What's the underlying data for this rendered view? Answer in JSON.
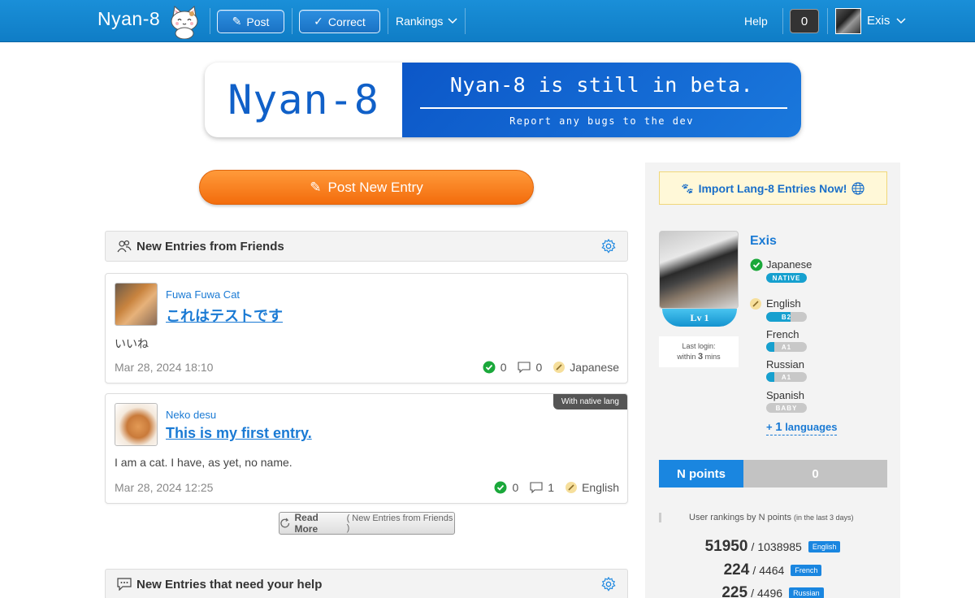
{
  "nav": {
    "brand": "Nyan-8",
    "post_label": "Post",
    "correct_label": "Correct",
    "rankings_label": "Rankings",
    "help_label": "Help",
    "notification_count": "0",
    "username": "Exis"
  },
  "banner": {
    "logo": "Nyan-8",
    "title": "Nyan-8 is still in beta.",
    "subtitle": "Report any bugs to the dev"
  },
  "post_new_entry_label": "Post New Entry",
  "friends_section": {
    "title": "New Entries from Friends",
    "entries": [
      {
        "author": "Fuwa Fuwa Cat",
        "title": "これはテストです",
        "body": "いいね",
        "date": "Mar 28, 2024 18:10",
        "corrections": "0",
        "comments": "0",
        "language": "Japanese"
      },
      {
        "author": "Neko desu",
        "title": "This is my first entry.",
        "body": "I am a cat. I have, as yet, no name.",
        "date": "Mar 28, 2024 12:25",
        "corrections": "0",
        "comments": "1",
        "language": "English",
        "tag": "With native lang"
      }
    ],
    "read_more": "Read More",
    "read_more_context": "( New Entries from Friends )"
  },
  "help_section": {
    "title": "New Entries that need your help"
  },
  "sidebar": {
    "import_label": "Import Lang-8 Entries Now!",
    "profile": {
      "name": "Exis",
      "level": "Lv 1",
      "last_login_label": "Last login:",
      "last_login_value_prefix": "within",
      "last_login_value_num": "3",
      "last_login_value_suffix": "mins"
    },
    "languages": [
      {
        "name": "Japanese",
        "level": "NATIVE",
        "fill": 1.0
      },
      {
        "name": "English",
        "level": "B2",
        "fill": 0.6
      },
      {
        "name": "French",
        "level": "A1",
        "fill": 0.2
      },
      {
        "name": "Russian",
        "level": "A1",
        "fill": 0.2
      },
      {
        "name": "Spanish",
        "level": "BABY",
        "fill": 0.0
      }
    ],
    "more_languages_prefix": "+",
    "more_languages_count": "1",
    "more_languages_suffix": "languages",
    "npoints_label": "N points",
    "npoints_value": "0",
    "rankings_title": "User rankings by N points",
    "rankings_title_note": "(in the last 3 days)",
    "rankings": [
      {
        "rank": "51950",
        "total": "1038985",
        "lang": "English"
      },
      {
        "rank": "224",
        "total": "4464",
        "lang": "French"
      },
      {
        "rank": "225",
        "total": "4496",
        "lang": "Russian"
      }
    ]
  },
  "colors": {
    "nav_blue": "#1587d2",
    "link_blue": "#1a7ad4",
    "orange": "#f57f1f",
    "green_check": "#1aa83a"
  }
}
